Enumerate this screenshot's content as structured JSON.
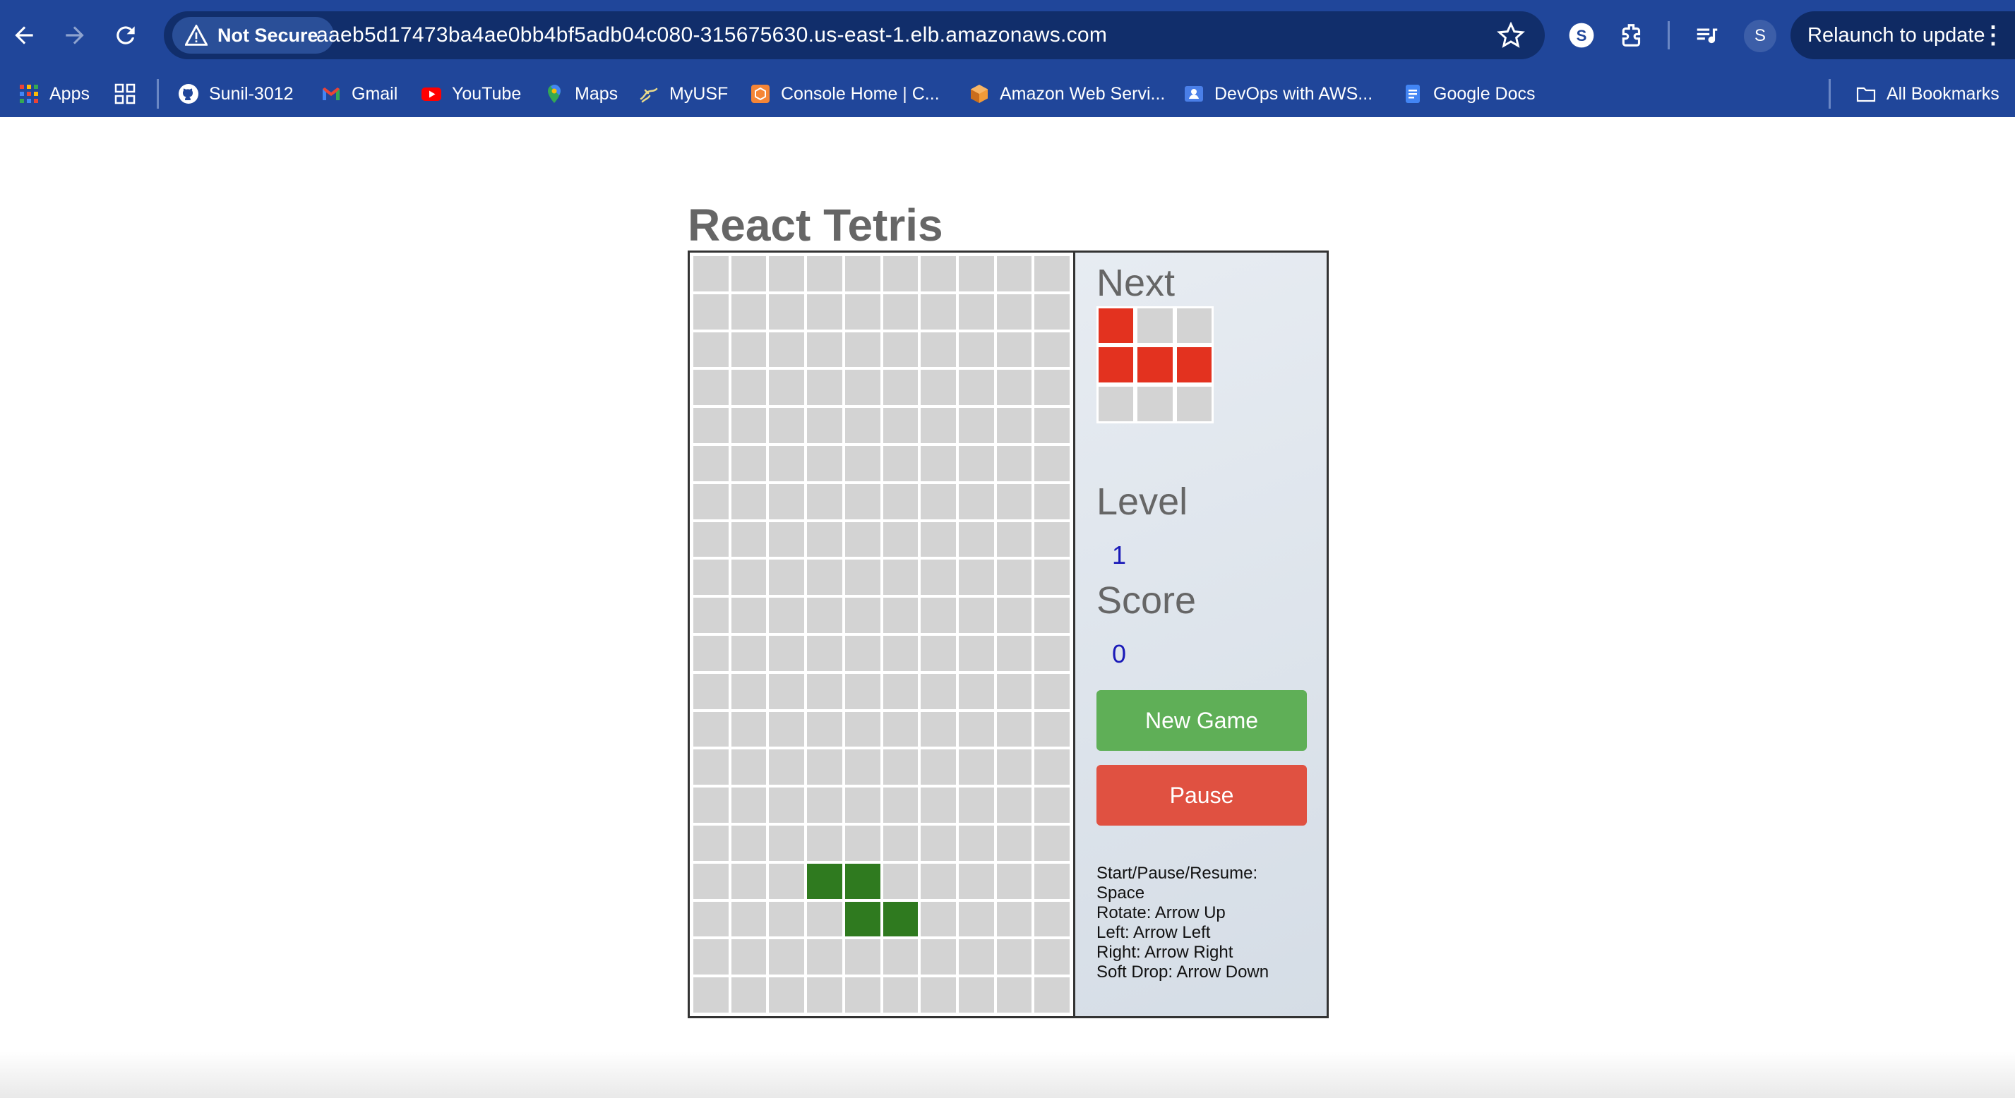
{
  "browser": {
    "security_label": "Not Secure",
    "url": "aaeb5d17473ba4ae0bb4bf5adb04c080-315675630.us-east-1.elb.amazonaws.com",
    "avatar_letter": "S",
    "relaunch_label": "Relaunch to update",
    "more_glyph": "⋮",
    "bookmarks": [
      {
        "label": "Apps",
        "icon": "apps-grid-icon"
      },
      {
        "label": "Sunil-3012",
        "icon": "github-icon"
      },
      {
        "label": "Gmail",
        "icon": "gmail-icon"
      },
      {
        "label": "YouTube",
        "icon": "youtube-icon"
      },
      {
        "label": "Maps",
        "icon": "maps-icon"
      },
      {
        "label": "MyUSF",
        "icon": "usf-icon"
      },
      {
        "label": "Console Home | C...",
        "icon": "aws-console-icon"
      },
      {
        "label": "Amazon Web Servi...",
        "icon": "aws-cube-icon"
      },
      {
        "label": "DevOps with AWS...",
        "icon": "classroom-icon"
      },
      {
        "label": "Google Docs",
        "icon": "docs-icon"
      }
    ],
    "all_bookmarks_label": "All Bookmarks"
  },
  "game": {
    "title": "React Tetris",
    "next_label": "Next",
    "level_label": "Level",
    "level_value": "1",
    "score_label": "Score",
    "score_value": "0",
    "new_game_label": "New Game",
    "pause_label": "Pause",
    "controls": [
      "Start/Pause/Resume:",
      "Space",
      "Rotate: Arrow Up",
      "Left: Arrow Left",
      "Right: Arrow Right",
      "Soft Drop: Arrow Down"
    ],
    "colors": {
      "active_piece": "#2f7a1f",
      "next_piece": "#e3321f",
      "empty_cell": "#d3d3d3",
      "new_game": "#5faf57",
      "pause": "#e05141"
    },
    "board": {
      "columns": 10,
      "rows": 20,
      "filled_cells": [
        [
          16,
          3
        ],
        [
          16,
          4
        ],
        [
          17,
          4
        ],
        [
          17,
          5
        ]
      ]
    },
    "next_piece": {
      "size": 3,
      "filled_cells": [
        [
          0,
          0
        ],
        [
          1,
          0
        ],
        [
          1,
          1
        ],
        [
          1,
          2
        ]
      ]
    }
  }
}
